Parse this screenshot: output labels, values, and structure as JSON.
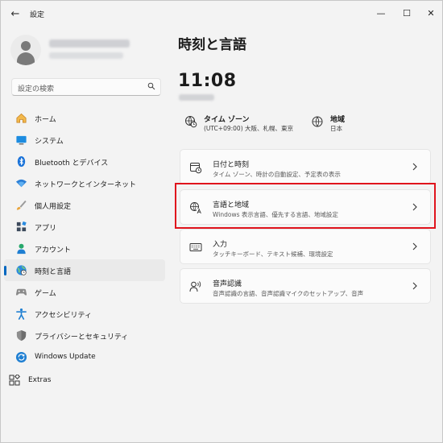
{
  "window": {
    "title": "設定"
  },
  "titlebar": {
    "back": "←",
    "minimize": "—",
    "maximize": "☐",
    "close": "✕"
  },
  "search": {
    "placeholder": "設定の検索"
  },
  "sidebar": {
    "items": [
      {
        "label": "ホーム",
        "icon": "home-icon"
      },
      {
        "label": "システム",
        "icon": "system-icon"
      },
      {
        "label": "Bluetooth とデバイス",
        "icon": "bluetooth-icon"
      },
      {
        "label": "ネットワークとインターネット",
        "icon": "network-icon"
      },
      {
        "label": "個人用設定",
        "icon": "personalization-icon"
      },
      {
        "label": "アプリ",
        "icon": "apps-icon"
      },
      {
        "label": "アカウント",
        "icon": "account-icon"
      },
      {
        "label": "時刻と言語",
        "icon": "time-language-icon",
        "selected": true
      },
      {
        "label": "ゲーム",
        "icon": "gaming-icon"
      },
      {
        "label": "アクセシビリティ",
        "icon": "accessibility-icon"
      },
      {
        "label": "プライバシーとセキュリティ",
        "icon": "privacy-icon"
      },
      {
        "label": "Windows Update",
        "icon": "windows-update-icon"
      }
    ],
    "extras": {
      "label": "Extras",
      "icon": "extras-icon"
    }
  },
  "main": {
    "title": "時刻と言語",
    "clock": "11:08",
    "timezone": {
      "title": "タイム ゾーン",
      "value": "(UTC+09:00) 大阪、札幌、東京"
    },
    "region": {
      "title": "地域",
      "value": "日本"
    },
    "cards": [
      {
        "title": "日付と時刻",
        "desc": "タイム ゾーン、時計の自動設定、予定表の表示",
        "icon": "date-time-icon"
      },
      {
        "title": "言語と地域",
        "desc": "Windows 表示言語、優先する言語、地域設定",
        "icon": "language-icon"
      },
      {
        "title": "入力",
        "desc": "タッチキーボード、テキスト候補、環境設定",
        "icon": "keyboard-icon"
      },
      {
        "title": "音声認識",
        "desc": "音声認識の言語、音声認識マイクのセットアップ、音声",
        "icon": "speech-icon"
      }
    ]
  },
  "colors": {
    "accent": "#0067c0",
    "highlight": "#e0141d",
    "background": "#f3f3f3",
    "card": "#fbfbfb"
  }
}
